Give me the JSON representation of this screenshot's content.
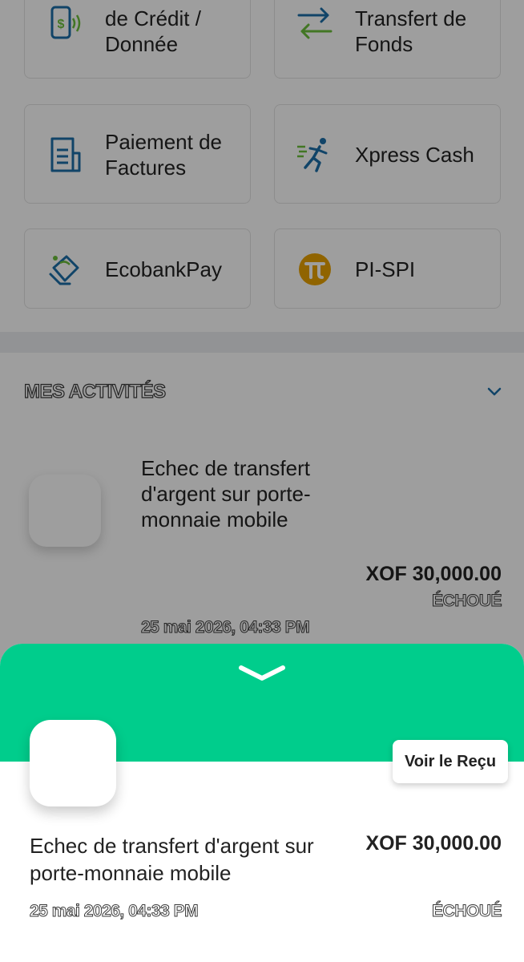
{
  "services": [
    {
      "label_line1": "de Crédit /",
      "label_line2": "Donnée",
      "icon": "phone-credit-icon"
    },
    {
      "label_line1": "Transfert de",
      "label_line2": "Fonds",
      "icon": "transfer-arrows-icon"
    },
    {
      "label_line1": "Paiement de",
      "label_line2": "Factures",
      "icon": "bill-icon"
    },
    {
      "label_line1": "Xpress Cash",
      "label_line2": "",
      "icon": "running-man-icon"
    },
    {
      "label_line1": "EcobankPay",
      "label_line2": "",
      "icon": "ecobankpay-icon"
    },
    {
      "label_line1": "PI-SPI",
      "label_line2": "",
      "icon": "pi-spi-icon"
    }
  ],
  "activities": {
    "title": "MES ACTIVITÉS",
    "item": {
      "description": "Echec de transfert d'argent sur porte-monnaie mobile",
      "amount": "XOF 30,000.00",
      "status": "ÉCHOUÉ",
      "date": "25 mai 2026, 04:33 PM"
    }
  },
  "sheet": {
    "receipt_button": "Voir le Reçu",
    "description": "Echec de transfert d'argent sur porte-monnaie mobile",
    "amount": "XOF 30,000.00",
    "date": "25 mai 2026, 04:33 PM",
    "status": "ÉCHOUÉ"
  },
  "colors": {
    "accent_green": "#00cd8c",
    "icon_blue": "#1c6fa8",
    "icon_green": "#6bbf3a",
    "pi_orange": "#e8a200"
  }
}
